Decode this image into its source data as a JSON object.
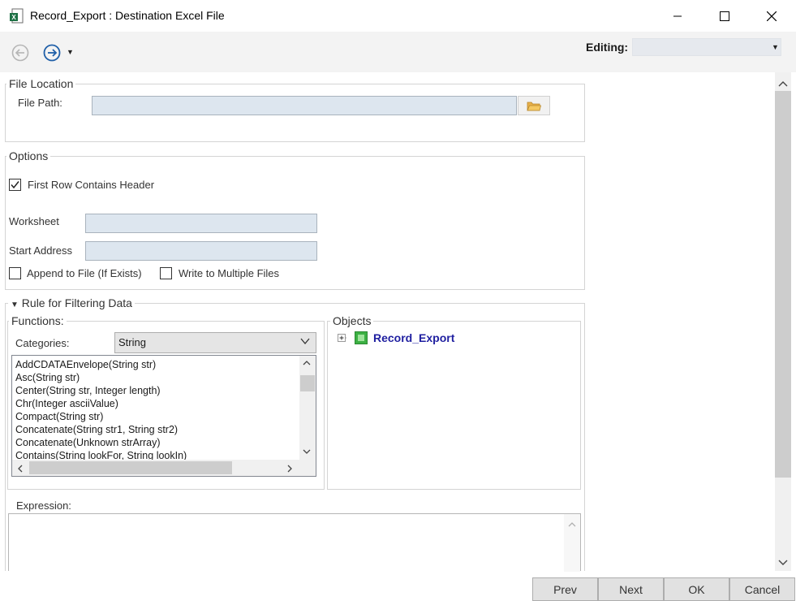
{
  "window": {
    "title": "Record_Export : Destination Excel File"
  },
  "toolbar": {
    "editing_label": "Editing:",
    "editing_value": ""
  },
  "file_location": {
    "legend": "File Location",
    "file_path_label": "File Path:",
    "file_path_value": ""
  },
  "options": {
    "legend": "Options",
    "first_row_header_label": "First Row Contains Header",
    "first_row_header_checked": true,
    "worksheet_label": "Worksheet",
    "worksheet_value": "",
    "start_address_label": "Start Address",
    "start_address_value": "",
    "append_label": "Append to File (If Exists)",
    "append_checked": false,
    "multiple_files_label": "Write to Multiple Files",
    "multiple_files_checked": false
  },
  "filter": {
    "legend": "Rule for Filtering Data",
    "functions_label": "Functions:",
    "categories_label": "Categories:",
    "categories_value": "String",
    "function_items": [
      "AddCDATAEnvelope(String str)",
      "Asc(String str)",
      "Center(String str, Integer length)",
      "Chr(Integer asciiValue)",
      "Compact(String str)",
      "Concatenate(String str1, String str2)",
      "Concatenate(Unknown strArray)",
      "Contains(String lookFor, String lookIn)"
    ],
    "objects_label": "Objects",
    "object_tree_root": "Record_Export",
    "expression_label": "Expression:",
    "expression_value": ""
  },
  "buttons": {
    "prev": "Prev",
    "next": "Next",
    "ok": "OK",
    "cancel": "Cancel"
  },
  "colors": {
    "field_bg": "#dde6ef",
    "tree_root_text": "#1f1fa0",
    "tree_node_green": "#3cb043",
    "nav_blue": "#1f5fa8"
  },
  "icons": {
    "app": "excel-file-icon",
    "back": "back-arrow-icon",
    "forward": "forward-arrow-icon",
    "browse": "folder-icon",
    "expand": "plus-box-icon"
  }
}
